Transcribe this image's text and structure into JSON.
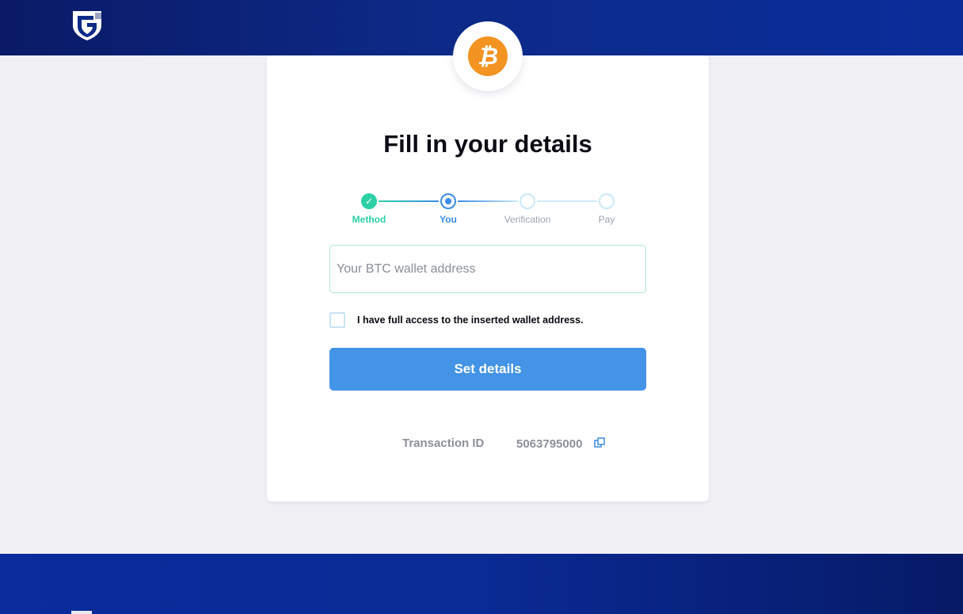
{
  "brand": {
    "logo_icon": "guardarian-shield-icon"
  },
  "coin": {
    "icon": "bitcoin-icon",
    "symbol": "₿",
    "color": "#f39321"
  },
  "page": {
    "title": "Fill in your details"
  },
  "stepper": {
    "steps": [
      {
        "label": "Method",
        "state": "done"
      },
      {
        "label": "You",
        "state": "current"
      },
      {
        "label": "Verification",
        "state": "todo"
      },
      {
        "label": "Pay",
        "state": "todo"
      }
    ]
  },
  "form": {
    "wallet_placeholder": "Your BTC wallet address",
    "wallet_value": "",
    "access_checkbox_label": "I have full access to the inserted wallet address.",
    "access_checked": false,
    "submit_label": "Set details"
  },
  "transaction": {
    "label": "Transaction ID",
    "id": "5063795000",
    "copy_icon": "copy-icon"
  },
  "colors": {
    "accent": "#4393e6",
    "success": "#2ccfa6",
    "header": "#0d2a88"
  }
}
